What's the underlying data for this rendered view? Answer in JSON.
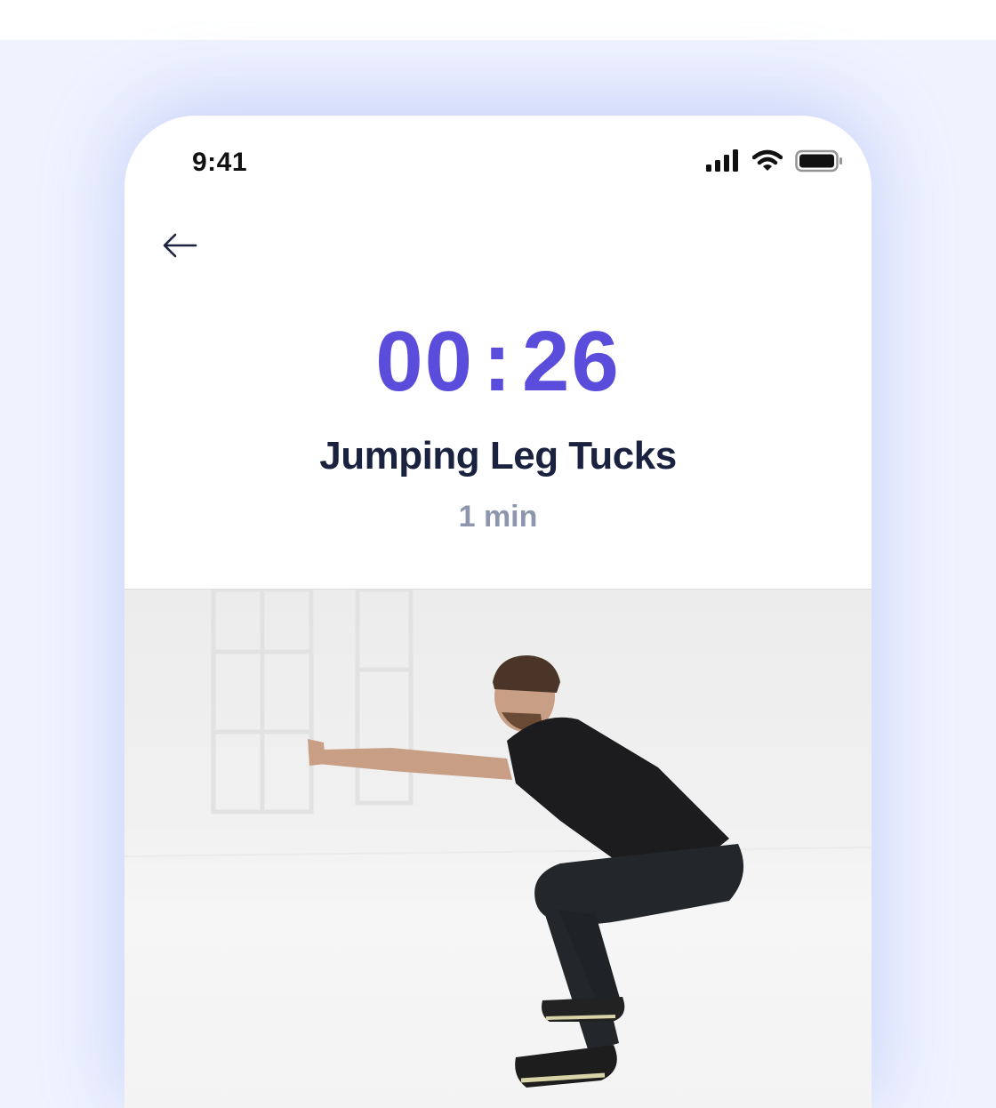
{
  "status_bar": {
    "time": "9:41"
  },
  "timer": {
    "minutes": "00",
    "separator": ":",
    "seconds": "26"
  },
  "exercise": {
    "name": "Jumping Leg Tucks",
    "duration": "1 min"
  },
  "icons": {
    "back": "arrow-left-icon",
    "signal": "cellular-signal-icon",
    "wifi": "wifi-icon",
    "battery": "battery-icon"
  },
  "colors": {
    "accent": "#5b4ddc",
    "title": "#1b2240",
    "subtle": "#8e96ad",
    "backdrop": "#eff3fe"
  }
}
